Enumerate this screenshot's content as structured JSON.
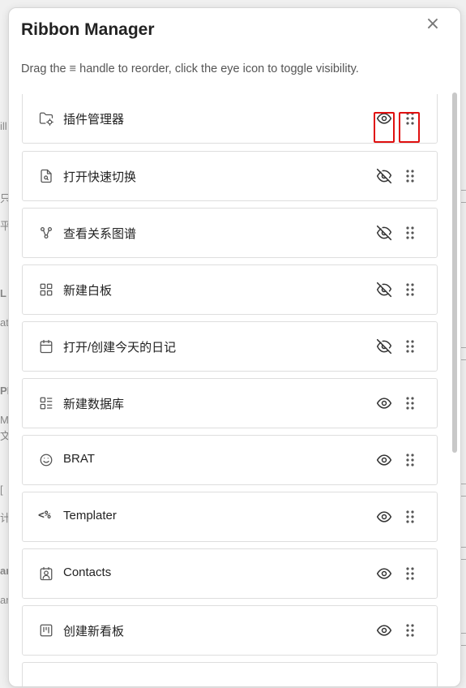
{
  "dialog": {
    "title": "Ribbon Manager",
    "description": "Drag the ≡ handle to reorder, click the eye icon to toggle visibility.",
    "close_label": "×"
  },
  "items": [
    {
      "label": "插件管理器",
      "icon": "folder-cog-icon",
      "visible": true
    },
    {
      "label": "打开快速切换",
      "icon": "file-search-icon",
      "visible": false
    },
    {
      "label": "查看关系图谱",
      "icon": "git-fork-icon",
      "visible": false
    },
    {
      "label": "新建白板",
      "icon": "layout-dashboard-icon",
      "visible": false
    },
    {
      "label": "打开/创建今天的日记",
      "icon": "calendar-icon",
      "visible": false
    },
    {
      "label": "新建数据库",
      "icon": "list-layout-icon",
      "visible": true
    },
    {
      "label": "BRAT",
      "icon": "smile-icon",
      "visible": true
    },
    {
      "label": "Templater",
      "icon": "templater-icon",
      "glyph": "<%",
      "visible": true
    },
    {
      "label": "Contacts",
      "icon": "contact-icon",
      "visible": true
    },
    {
      "label": "创建新看板",
      "icon": "kanban-icon",
      "visible": true
    }
  ],
  "background_fragments": [
    "ill",
    "只",
    "平",
    "L",
    "ati",
    "PI",
    "M",
    "文",
    "[",
    "计",
    "ar",
    "ar"
  ],
  "colors": {
    "highlight": "#e01010",
    "border": "#dedede",
    "text": "#222222"
  }
}
